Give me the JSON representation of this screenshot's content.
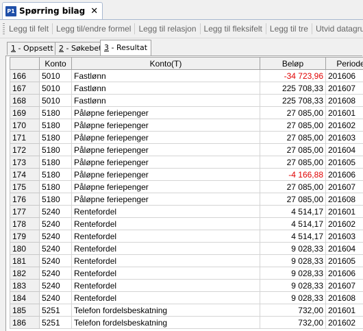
{
  "document_tab": {
    "icon_text": "P1",
    "title": "Spørring bilag",
    "close": "✕"
  },
  "toolbar": {
    "items": [
      "Legg til felt",
      "Legg til/endre formel",
      "Legg til relasjon",
      "Legg til fleksifelt",
      "Legg til tre",
      "Utvid datagrunnlag"
    ]
  },
  "sub_tabs": [
    {
      "key": "1",
      "label": " - Oppsett"
    },
    {
      "key": "2",
      "label": " - Søkebet"
    },
    {
      "key": "3",
      "label": " - Resultat"
    }
  ],
  "grid": {
    "columns": [
      "",
      "Konto",
      "Konto(T)",
      "Beløp",
      "Periode"
    ],
    "rows": [
      {
        "n": "166",
        "konto": "5010",
        "kontot": "Fastlønn",
        "belop": "-34 723,96",
        "periode": "201606",
        "negative": true
      },
      {
        "n": "167",
        "konto": "5010",
        "kontot": "Fastlønn",
        "belop": "225 708,33",
        "periode": "201607"
      },
      {
        "n": "168",
        "konto": "5010",
        "kontot": "Fastlønn",
        "belop": "225 708,33",
        "periode": "201608"
      },
      {
        "n": "169",
        "konto": "5180",
        "kontot": "Påløpne feriepenger",
        "belop": "27 085,00",
        "periode": "201601"
      },
      {
        "n": "170",
        "konto": "5180",
        "kontot": "Påløpne feriepenger",
        "belop": "27 085,00",
        "periode": "201602"
      },
      {
        "n": "171",
        "konto": "5180",
        "kontot": "Påløpne feriepenger",
        "belop": "27 085,00",
        "periode": "201603"
      },
      {
        "n": "172",
        "konto": "5180",
        "kontot": "Påløpne feriepenger",
        "belop": "27 085,00",
        "periode": "201604"
      },
      {
        "n": "173",
        "konto": "5180",
        "kontot": "Påløpne feriepenger",
        "belop": "27 085,00",
        "periode": "201605"
      },
      {
        "n": "174",
        "konto": "5180",
        "kontot": "Påløpne feriepenger",
        "belop": "-4 166,88",
        "periode": "201606",
        "negative": true
      },
      {
        "n": "175",
        "konto": "5180",
        "kontot": "Påløpne feriepenger",
        "belop": "27 085,00",
        "periode": "201607"
      },
      {
        "n": "176",
        "konto": "5180",
        "kontot": "Påløpne feriepenger",
        "belop": "27 085,00",
        "periode": "201608"
      },
      {
        "n": "177",
        "konto": "5240",
        "kontot": "Rentefordel",
        "belop": "4 514,17",
        "periode": "201601"
      },
      {
        "n": "178",
        "konto": "5240",
        "kontot": "Rentefordel",
        "belop": "4 514,17",
        "periode": "201602"
      },
      {
        "n": "179",
        "konto": "5240",
        "kontot": "Rentefordel",
        "belop": "4 514,17",
        "periode": "201603"
      },
      {
        "n": "180",
        "konto": "5240",
        "kontot": "Rentefordel",
        "belop": "9 028,33",
        "periode": "201604"
      },
      {
        "n": "181",
        "konto": "5240",
        "kontot": "Rentefordel",
        "belop": "9 028,33",
        "periode": "201605"
      },
      {
        "n": "182",
        "konto": "5240",
        "kontot": "Rentefordel",
        "belop": "9 028,33",
        "periode": "201606"
      },
      {
        "n": "183",
        "konto": "5240",
        "kontot": "Rentefordel",
        "belop": "9 028,33",
        "periode": "201607"
      },
      {
        "n": "184",
        "konto": "5240",
        "kontot": "Rentefordel",
        "belop": "9 028,33",
        "periode": "201608"
      },
      {
        "n": "185",
        "konto": "5251",
        "kontot": "Telefon fordelsbeskatning",
        "belop": "732,00",
        "periode": "201601"
      },
      {
        "n": "186",
        "konto": "5251",
        "kontot": "Telefon fordelsbeskatning",
        "belop": "732,00",
        "periode": "201602"
      }
    ]
  },
  "colors": {
    "negative": "#e00000",
    "icon_bg": "#1f4fa8"
  }
}
